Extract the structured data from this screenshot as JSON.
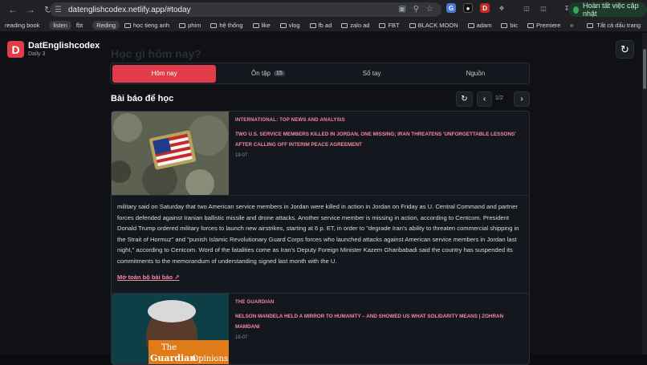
{
  "browser": {
    "url": "datenglishcodex.netlify.app/#today",
    "update_label": "Hoàn tất việc cập nhật",
    "bookmarks": [
      {
        "label": "reading book",
        "pill": false
      },
      {
        "label": "listen",
        "pill": true
      },
      {
        "label": "fbt",
        "pill": false
      },
      {
        "label": "Reding",
        "pill": true
      },
      {
        "label": "học tieng anh",
        "folder": true
      },
      {
        "label": "phim",
        "folder": true
      },
      {
        "label": "hệ thống",
        "folder": true
      },
      {
        "label": "like",
        "folder": true
      },
      {
        "label": "vlog",
        "folder": true
      },
      {
        "label": "fb ad",
        "folder": true
      },
      {
        "label": "zalo ad",
        "folder": true
      },
      {
        "label": "FBT",
        "folder": true
      },
      {
        "label": "BLACK MOON",
        "folder": true
      },
      {
        "label": "adam",
        "folder": true
      },
      {
        "label": "bic",
        "folder": true
      },
      {
        "label": "Premiere",
        "folder": true
      }
    ],
    "all_bookmarks": "Tất cả dấu trang"
  },
  "app": {
    "logo_letter": "D",
    "brand": "DatEnglishcodex",
    "subtitle": "Daily 3",
    "ghost_title": "Học gì hôm nay?",
    "tabs": [
      {
        "label": "Hôm nay",
        "badge": ""
      },
      {
        "label": "Ôn tập",
        "badge": "15"
      },
      {
        "label": "Sổ tay",
        "badge": ""
      },
      {
        "label": "Nguồn",
        "badge": ""
      }
    ],
    "section_title": "Bài báo để học",
    "pager": "1/2"
  },
  "articles": [
    {
      "source": "INTERNATIONAL: TOP NEWS AND ANALYSIS",
      "headline": "TWO U.S. SERVICE MEMBERS KILLED IN JORDAN, ONE MISSING; IRAN THREATENS 'UNFORGETTABLE LESSONS' AFTER CALLING OFF INTERIM PEACE AGREEMENT",
      "date": "19-07",
      "body": "military said on Saturday that two American service members in Jordan were killed in action in Jordan on Friday as U. Central Command and partner forces defended against Iranian ballistic missile and drone attacks. Another service member is missing in action, according to Centcom. President Donald Trump ordered military forces to launch new airstrikes, starting at 6 p. ET, in order to \"degrade Iran's ability to threaten commercial shipping in the Strait of Hormuz\" and \"punish Islamic Revolutionary Guard Corps forces who launched attacks against American service members in Jordan last night,\" according to Centcom. Word of the fatalities come as Iran's Deputy Foreign Minister Kazem Gharibabadi said the country has suspended its commitments to the memorandum of understanding signed last month with the U.",
      "read_more": "Mở toàn bộ bài báo ↗"
    },
    {
      "source": "THE GUARDIAN",
      "headline": "NELSON MANDELA HELD A MIRROR TO HUMANITY – AND SHOWED US WHAT SOLIDARITY MEANS | ZOHRAN MAMDANI",
      "date": "18-07",
      "thumb_text_1": "The",
      "thumb_text_2": "Guardian",
      "thumb_text_3": "Opinions"
    }
  ],
  "colors": {
    "accent": "#e23b4a",
    "link": "#f48aa0"
  }
}
